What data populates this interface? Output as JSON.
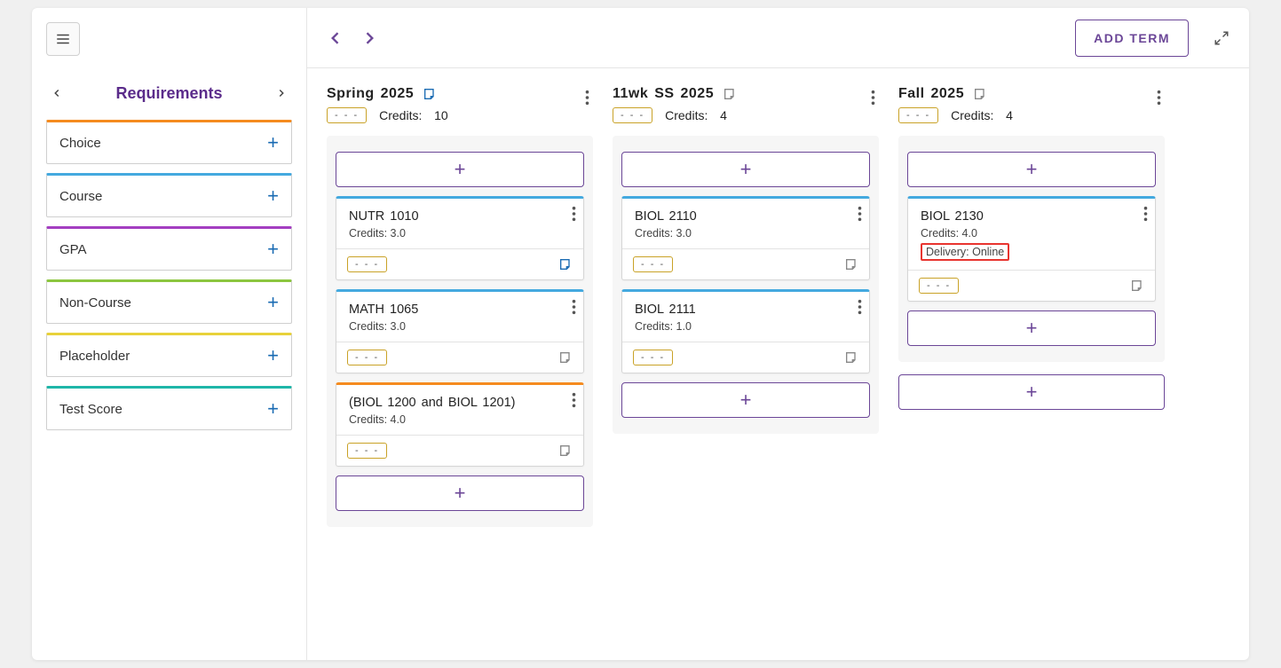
{
  "sidebar": {
    "title": "Requirements",
    "items": [
      {
        "label": "Choice",
        "color": "orange"
      },
      {
        "label": "Course",
        "color": "blue"
      },
      {
        "label": "GPA",
        "color": "purple"
      },
      {
        "label": "Non-Course",
        "color": "green"
      },
      {
        "label": "Placeholder",
        "color": "yellow"
      },
      {
        "label": "Test Score",
        "color": "teal"
      }
    ]
  },
  "toolbar": {
    "add_term_label": "ADD TERM"
  },
  "pill_text": "- - -",
  "credits_label": "Credits:",
  "terms": [
    {
      "title": "Spring 2025",
      "note_active": true,
      "credits": "10",
      "courses": [
        {
          "name": "NUTR 1010",
          "credits": "Credits: 3.0",
          "color": "blue",
          "note_active": true
        },
        {
          "name": "MATH 1065",
          "credits": "Credits: 3.0",
          "color": "blue",
          "note_active": false
        },
        {
          "name": "(BIOL 1200 and BIOL 1201)",
          "credits": "Credits: 4.0",
          "color": "orange",
          "note_active": false
        }
      ]
    },
    {
      "title": "11wk SS 2025",
      "note_active": false,
      "credits": "4",
      "courses": [
        {
          "name": "BIOL 2110",
          "credits": "Credits: 3.0",
          "color": "blue",
          "note_active": false
        },
        {
          "name": "BIOL 2111",
          "credits": "Credits: 1.0",
          "color": "blue",
          "note_active": false
        }
      ]
    },
    {
      "title": "Fall 2025",
      "note_active": false,
      "credits": "4",
      "courses": [
        {
          "name": "BIOL 2130",
          "credits": "Credits: 4.0",
          "color": "blue",
          "note_active": false,
          "extra": "Delivery: Online",
          "highlight": true
        }
      ]
    }
  ]
}
